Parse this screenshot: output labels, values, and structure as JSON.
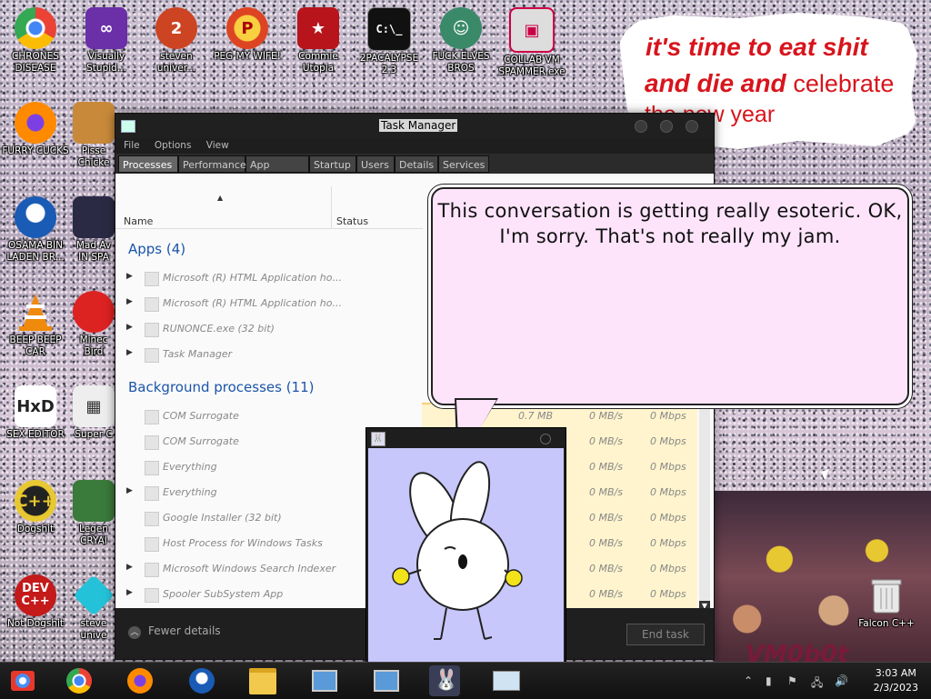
{
  "desktop": {
    "icons": [
      {
        "label": "CHRONES DISEASE",
        "icon": "chrome-icon"
      },
      {
        "label": "Visually Stupid...",
        "icon": "visual-studio-icon"
      },
      {
        "label": "steven univer...",
        "icon": "steven-icon"
      },
      {
        "label": "PEG MY WIFE!",
        "icon": "peg-icon"
      },
      {
        "label": "Commie Utopia",
        "icon": "commie-icon"
      },
      {
        "label": "2PACALYPSE 2.3",
        "icon": "console-icon"
      },
      {
        "label": "FUCK ELVES BROS",
        "icon": "elf-icon"
      },
      {
        "label": "COLLAB VM SPAMMER.exe",
        "icon": "collab-icon"
      },
      {
        "label": "FURRY CUCKS",
        "icon": "firefox-icon"
      },
      {
        "label": "Pisse Chicke",
        "icon": "chicken-icon"
      },
      {
        "label": "OSAMA BIN LADEN BR...",
        "icon": "obama-icon"
      },
      {
        "label": "Mad Av IN SPA",
        "icon": "angry-birds-space-icon"
      },
      {
        "label": "BEEP BEEP CAR",
        "icon": "vlc-icon"
      },
      {
        "label": "Minec Bird",
        "icon": "angry-birds-icon"
      },
      {
        "label": "SEX EDITOR",
        "icon": "hxd-icon"
      },
      {
        "label": "Super C",
        "icon": "super-c-icon"
      },
      {
        "label": "Dogshit",
        "icon": "dogshit-icon"
      },
      {
        "label": "Legen CRYAI",
        "icon": "legend-icon"
      },
      {
        "label": "Not Dogshit",
        "icon": "devcpp-icon"
      },
      {
        "label": "steve unive",
        "icon": "gem-icon"
      },
      {
        "label": "Falcon C++",
        "icon": "recycle-bin-icon"
      }
    ],
    "wallpaper_tag": "VM0b0t"
  },
  "top_bubble": {
    "line1": "it's time to eat shit",
    "line2_bold": "and die and",
    "line2_soft": "celebrate",
    "line3": "the new year"
  },
  "task_manager": {
    "title": "Task Manager",
    "menu": [
      "File",
      "Options",
      "View"
    ],
    "tabs": [
      "Processes",
      "Performance",
      "App history",
      "Startup",
      "Users",
      "Details",
      "Services"
    ],
    "columns": {
      "name": "Name",
      "status": "Status"
    },
    "apps_header": "Apps (4)",
    "apps": [
      {
        "name": "Microsoft (R) HTML Application ho..."
      },
      {
        "name": "Microsoft (R) HTML Application ho..."
      },
      {
        "name": "RUNONCE.exe (32 bit)"
      },
      {
        "name": "Task Manager"
      }
    ],
    "bg_header": "Background processes (11)",
    "background": [
      {
        "name": "COM Surrogate",
        "mem": "0.7 MB",
        "disk": "0 MB/s",
        "net": "0 Mbps"
      },
      {
        "name": "COM Surrogate",
        "mem": "",
        "disk": "0 MB/s",
        "net": "0 Mbps"
      },
      {
        "name": "Everything",
        "mem": "",
        "disk": "0 MB/s",
        "net": "0 Mbps"
      },
      {
        "name": "Everything",
        "mem": "",
        "disk": "0 MB/s",
        "net": "0 Mbps"
      },
      {
        "name": "Google Installer (32 bit)",
        "mem": "",
        "disk": "0 MB/s",
        "net": "0 Mbps"
      },
      {
        "name": "Host Process for Windows Tasks",
        "mem": "",
        "disk": "0 MB/s",
        "net": "0 Mbps"
      },
      {
        "name": "Microsoft Windows Search Indexer",
        "mem": "",
        "disk": "0 MB/s",
        "net": "0 Mbps"
      },
      {
        "name": "Spooler SubSystem App",
        "mem": "",
        "disk": "0 MB/s",
        "net": "0 Mbps"
      }
    ],
    "fewer_details": "Fewer details",
    "end_task": "End task"
  },
  "speech_bubble": {
    "text": "This conversation is getting really esoteric. OK, I'm sorry. That's not really my jam."
  },
  "taskbar": {
    "time": "3:03 AM",
    "date": "2/3/2023"
  }
}
